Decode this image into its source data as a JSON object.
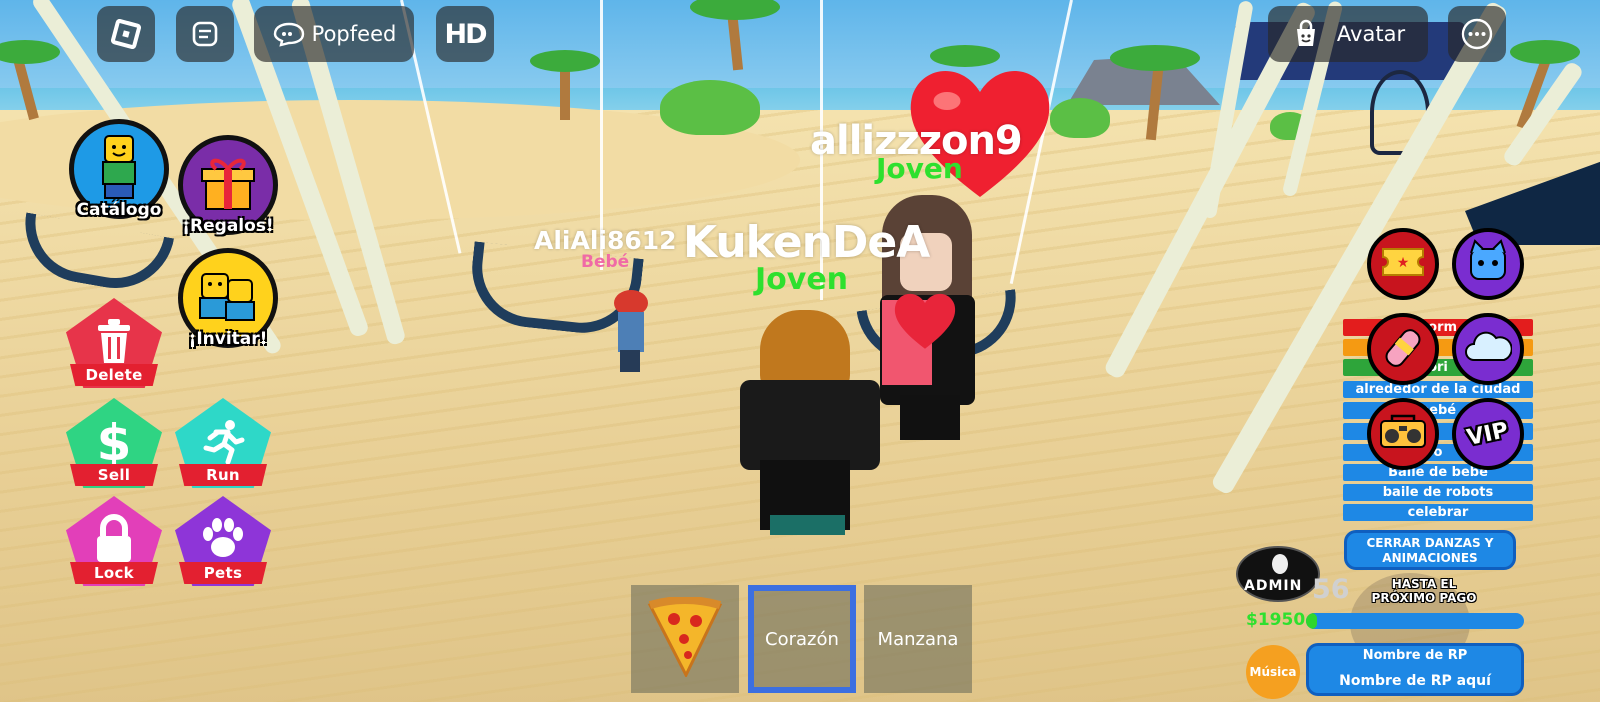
{
  "topbar": {
    "popfeed_label": "Popfeed",
    "hd_label": "HD",
    "avatar_label": "Avatar",
    "icons": [
      "roblox-logo-icon",
      "chat-icon",
      "popfeed-icon",
      "hd-icon",
      "shopping-bag-icon",
      "more-icon"
    ]
  },
  "left_menu": {
    "catalog": "Catálogo",
    "gifts": "¡Regalos!",
    "invite": "¡Invitar!",
    "delete": "Delete",
    "sell": "Sell",
    "run": "Run",
    "lock": "Lock",
    "pets": "Pets"
  },
  "players": [
    {
      "name": "allizzzon9",
      "age": "Joven"
    },
    {
      "name": "KukenDeA",
      "age": "Joven"
    },
    {
      "name": "AliAli8612",
      "age": "Bebé"
    }
  ],
  "hotbar": {
    "slots": [
      {
        "label": "",
        "icon": "pizza-icon"
      },
      {
        "label": "Corazón",
        "icon": ""
      },
      {
        "label": "Manzana",
        "icon": ""
      }
    ],
    "selected_index": 1
  },
  "dance_menu": {
    "items": [
      "norm",
      "",
      "ori",
      "alrededor de la ciudad",
      "bebé",
      "",
      "o",
      "Baile de bebé",
      "baile de robots",
      "celebrar"
    ],
    "close_button": "CERRAR DANZAS Y ANIMACIONES"
  },
  "right_badges": {
    "vip_label": "VIP",
    "icons": [
      "ticket-icon",
      "pet-icon",
      "paint-icon",
      "cloud-icon",
      "boombox-icon",
      "vip-icon"
    ]
  },
  "status": {
    "admin_label": "ADMIN",
    "timer": "56",
    "next_pay_label": "HASTA EL PRÓXIMO PAGO",
    "money": "$1950",
    "pay_progress": 0.05
  },
  "rp": {
    "music_label": "Música",
    "title": "Nombre de RP",
    "placeholder": "Nombre de RP aquí"
  },
  "colors": {
    "pent_red": "#e7344a",
    "pent_green": "#2fd483",
    "pent_teal": "#2ed8c8",
    "pent_pink": "#e23fb9",
    "pent_purple": "#8e35d8",
    "rp_blue": "#1e88e5"
  }
}
